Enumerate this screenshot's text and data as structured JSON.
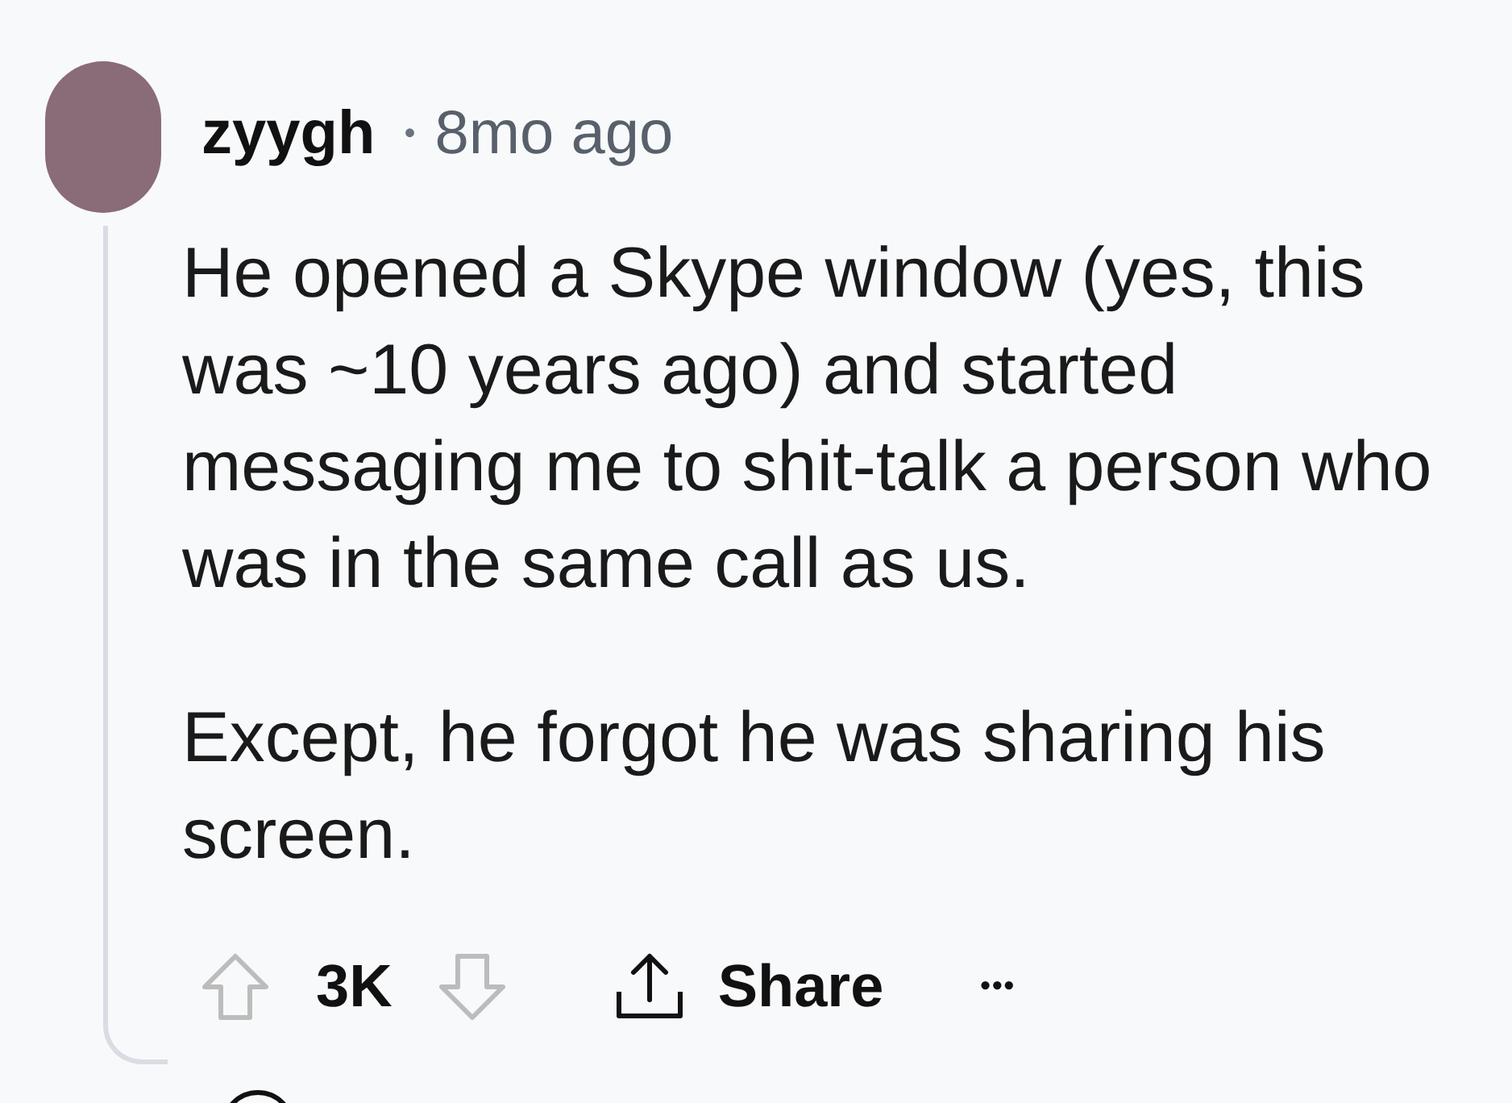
{
  "comment": {
    "author": "zyygh",
    "separator": "•",
    "time": "8mo ago",
    "paragraphs": [
      "He opened a Skype window (yes, this was ~10 years ago) and started messaging me to shit-talk a person who was in the same call as us.",
      "Except, he forgot he was sharing his screen."
    ],
    "actions": {
      "score": "3K",
      "share": "Share",
      "more": "•••"
    }
  }
}
